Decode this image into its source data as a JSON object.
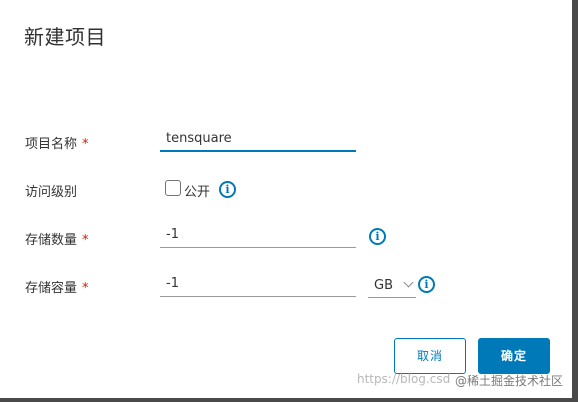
{
  "dialog": {
    "title": "新建项目"
  },
  "form": {
    "name_label": "项目名称",
    "name_value": "tensquare",
    "access_label": "访问级别",
    "public_label": "公开",
    "storage_count_label": "存储数量",
    "storage_count_value": "-1",
    "storage_size_label": "存储容量",
    "storage_size_value": "-1",
    "unit_value": "GB",
    "required_mark": "*"
  },
  "buttons": {
    "cancel": "取消",
    "ok": "确定"
  },
  "watermark": {
    "url": "https://blog.csd",
    "credit": "@稀土掘金技术社区"
  },
  "colors": {
    "accent": "#0079b8",
    "required": "#c92100"
  }
}
